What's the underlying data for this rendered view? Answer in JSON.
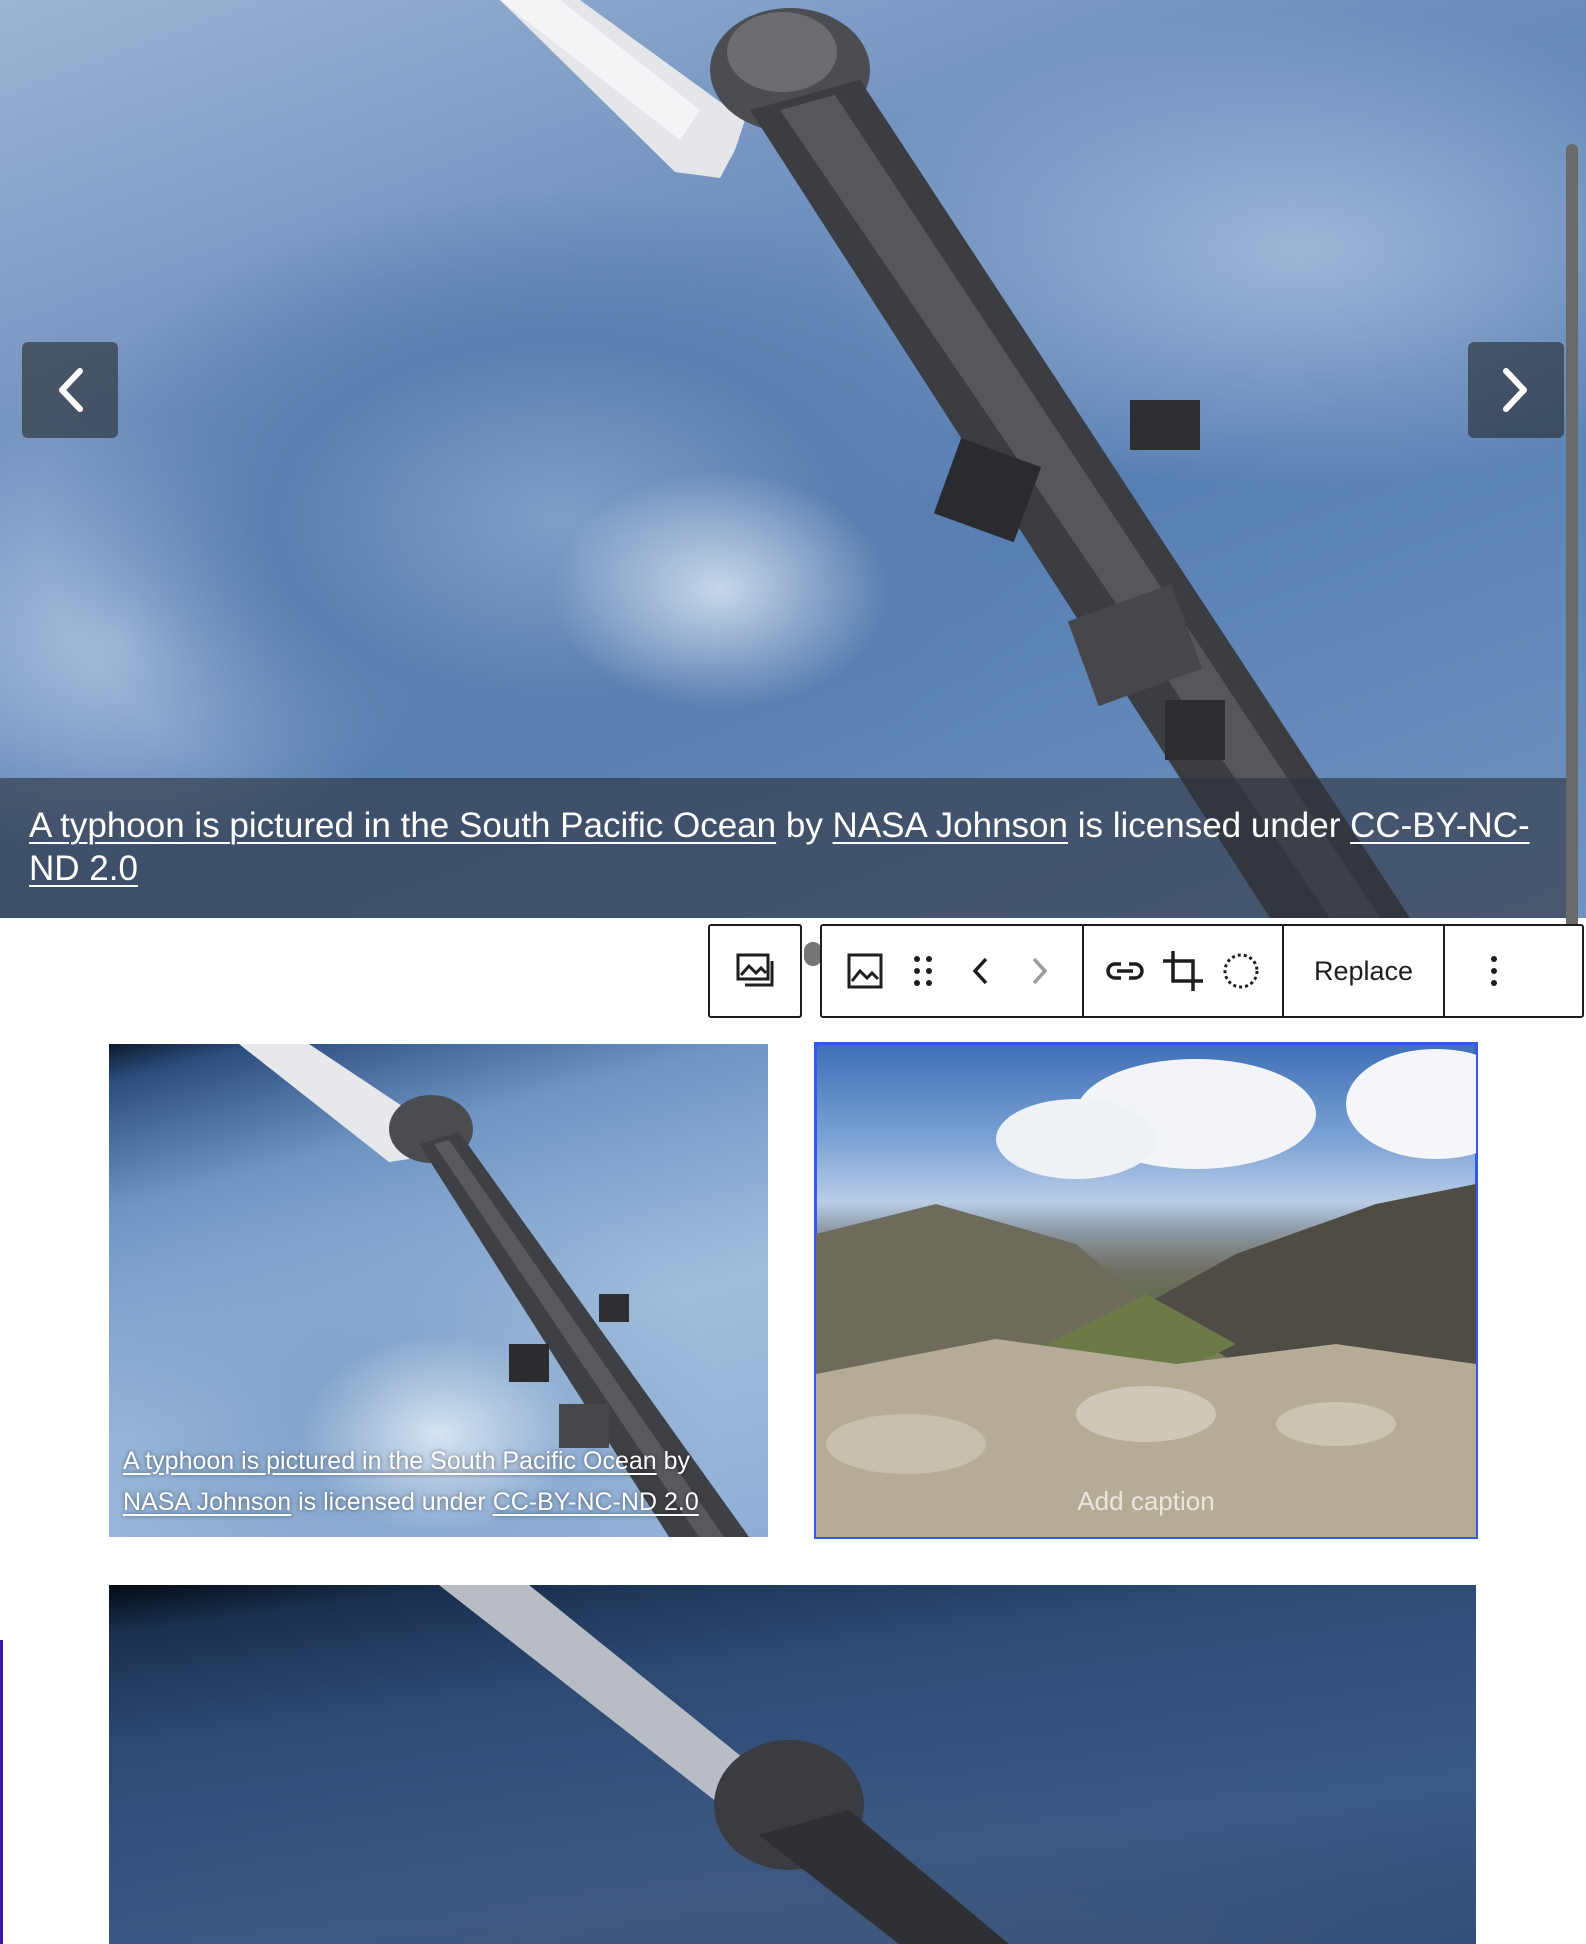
{
  "hero": {
    "caption": {
      "title_link": "A typhoon is pictured in the South Pacific Ocean",
      "by": " by ",
      "author_link": "NASA Johnson",
      "licensed": " is licensed under ",
      "license_link": "CC-BY-NC-ND 2.0"
    }
  },
  "toolbar": {
    "parent_icon": "gallery-parent-icon",
    "groups": [
      [
        "image-icon",
        "drag-handle-icon",
        "chevron-left-icon",
        "chevron-right-icon"
      ],
      [
        "link-icon",
        "crop-icon",
        "circle-dashed-icon"
      ],
      [
        "Replace"
      ],
      [
        "more-options-icon"
      ]
    ],
    "replace_label": "Replace"
  },
  "gallery": {
    "item1": {
      "title_link": "A typhoon is pictured in the South Pacific Ocean",
      "by": " by",
      "author_link": "NASA Johnson",
      "licensed": " is licensed under ",
      "license_link": "CC-BY-NC-ND 2.0"
    },
    "item2": {
      "caption_placeholder": "Add caption"
    }
  },
  "colors": {
    "accent": "#3858e9",
    "toolbar_border": "#1e1e1e"
  }
}
